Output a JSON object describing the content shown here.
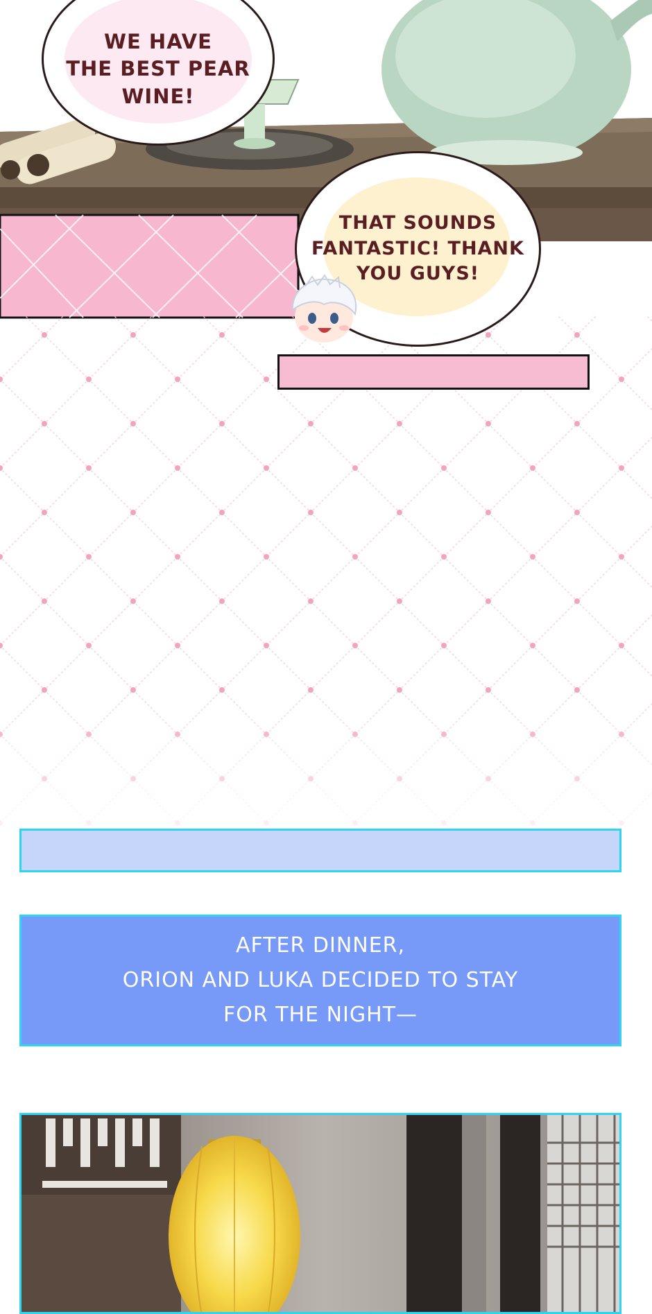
{
  "bubbles": {
    "pear_wine": "WE HAVE\nTHE BEST PEAR\nWINE!",
    "thank_you": "THAT SOUNDS\nFANTASTIC! THANK\nYOU GUYS!"
  },
  "narration": {
    "text": "AFTER DINNER,\nORION AND LUKA DECIDED TO STAY\nFOR THE NIGHT—"
  },
  "colors": {
    "pink_strip": "#f7b8cf",
    "blue_caption": "#7799f7",
    "light_blue_caption": "#c6d6fb",
    "caption_border": "#2fd4f2",
    "pattern_dot": "#f2a3bd"
  }
}
